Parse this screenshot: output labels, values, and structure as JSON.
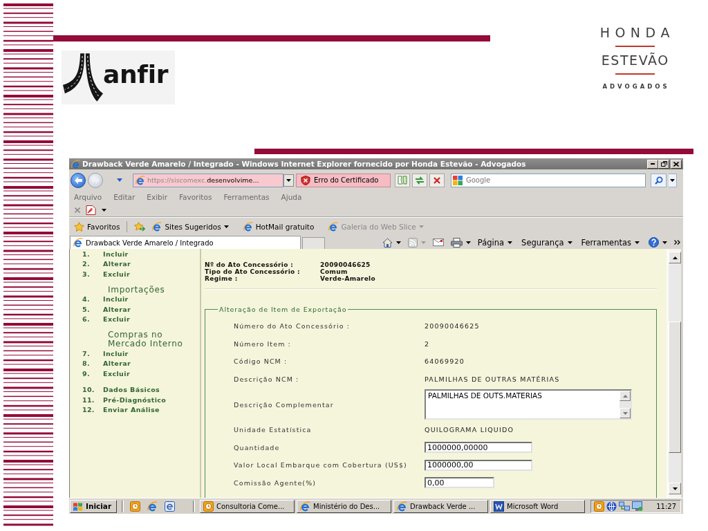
{
  "slide": {
    "left_logo": {
      "text": "anfir"
    },
    "right_logo": {
      "lines": [
        {
          "kind": "name",
          "text": "HONDA"
        },
        {
          "kind": "name",
          "text": "ESTEVÃO"
        },
        {
          "kind": "tagline",
          "text": "ADVOGADOS"
        }
      ]
    }
  },
  "window": {
    "title": "Drawback Verde Amarelo / Integrado - Windows Internet Explorer fornecido por Honda Estevão - Advogados"
  },
  "address_bar": {
    "nav_buttons": [
      {
        "kind": "back",
        "disabled": false
      },
      {
        "kind": "forward",
        "disabled": true
      }
    ],
    "url_start": "https://siscomexc.",
    "url_end": "desenvolvime...",
    "certificate_error": "Erro do Certificado",
    "search": {
      "placeholder": "Google"
    }
  },
  "menu": [
    "Arquivo",
    "Editar",
    "Exibir",
    "Favoritos",
    "Ferramentas",
    "Ajuda"
  ],
  "favorites_bar": {
    "label": "Favoritos",
    "links": [
      {
        "label": "Sites Sugeridos",
        "dropdown": true,
        "disabled": false
      },
      {
        "label": "HotMail gratuito",
        "dropdown": false,
        "disabled": false
      },
      {
        "label": "Galeria do Web Slice",
        "dropdown": true,
        "disabled": true
      }
    ]
  },
  "tabs": [
    {
      "label": "Drawback Verde Amarelo / Integrado",
      "selected": true
    }
  ],
  "command_bar": [
    "Página",
    "Segurança",
    "Ferramentas"
  ],
  "sidebar": {
    "sections": [
      {
        "items": [
          {
            "number": "1.",
            "label": "Incluir"
          },
          {
            "number": "2.",
            "label": "Alterar"
          },
          {
            "number": "3.",
            "label": "Excluir"
          }
        ]
      },
      {
        "heading": "Importações",
        "items": [
          {
            "number": "4.",
            "label": "Incluir"
          },
          {
            "number": "5.",
            "label": "Alterar"
          },
          {
            "number": "6.",
            "label": "Excluir"
          }
        ]
      },
      {
        "heading": "Compras no Mercado Interno",
        "items": [
          {
            "number": "7.",
            "label": "Incluir"
          },
          {
            "number": "8.",
            "label": "Alterar"
          },
          {
            "number": "9.",
            "label": "Excluir"
          }
        ]
      },
      {
        "items": [
          {
            "number": "10.",
            "label": "Dados Básicos"
          },
          {
            "number": "11.",
            "label": "Pré-Diagnóstico"
          },
          {
            "number": "12.",
            "label": "Enviar Análise"
          }
        ]
      }
    ]
  },
  "record": [
    {
      "label": "Nº do Ato Concessório :",
      "value": "20090046625"
    },
    {
      "label": "Tipo do Ato Concessório :",
      "value": "Comum"
    },
    {
      "label": "Regime :",
      "value": "Verde-Amarelo"
    }
  ],
  "form": {
    "legend": "Alteração de Item de Exportação",
    "rows": [
      {
        "kind": "text",
        "label": "Número do Ato Concessório :",
        "value": "20090046625"
      },
      {
        "kind": "text",
        "label": "Número Item :",
        "value": "2"
      },
      {
        "kind": "text",
        "label": "Código NCM :",
        "value": "64069920"
      },
      {
        "kind": "text",
        "label": "Descrição NCM :",
        "value": "PALMILHAS DE OUTRAS MATÉRIAS"
      },
      {
        "kind": "textarea",
        "label": "Descrição Complementar",
        "value": "PALMILHAS DE OUTS.MATERIAS"
      },
      {
        "kind": "text",
        "label": "Unidade Estatística",
        "value": "QUILOGRAMA LIQUIDO"
      },
      {
        "kind": "input",
        "label": "Quantidade",
        "value": "1000000,00000"
      },
      {
        "kind": "input",
        "label": "Valor Local Embarque com Cobertura (US$)",
        "value": "1000000,00"
      },
      {
        "kind": "shortinput",
        "label": "Comissão Agente(%)",
        "value": "0,00"
      }
    ]
  },
  "taskbar": {
    "start": "Iniciar",
    "tasks": [
      {
        "kind": "clock",
        "label": "Consultoria Come..."
      },
      {
        "kind": "browser",
        "label": "Ministério do Des..."
      },
      {
        "kind": "browser",
        "label": "Drawback Verde ..."
      },
      {
        "kind": "document",
        "label": "Microsoft Word"
      }
    ],
    "clock": "11:27"
  }
}
